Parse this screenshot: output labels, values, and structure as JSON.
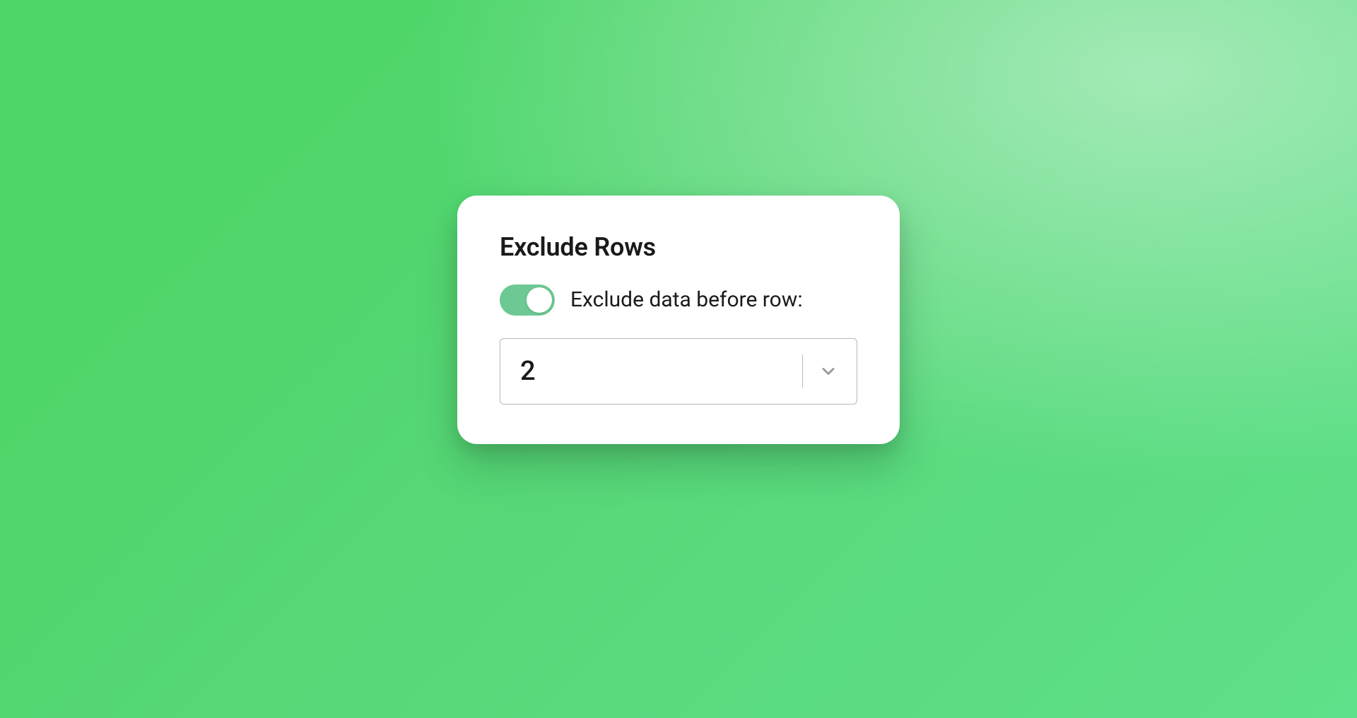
{
  "card": {
    "title": "Exclude Rows",
    "toggle": {
      "enabled": true,
      "label": "Exclude data before row:"
    },
    "select": {
      "value": "2"
    }
  },
  "colors": {
    "accent": "#6cc993",
    "background_start": "#4fd66a",
    "background_end": "#5fe08a"
  }
}
